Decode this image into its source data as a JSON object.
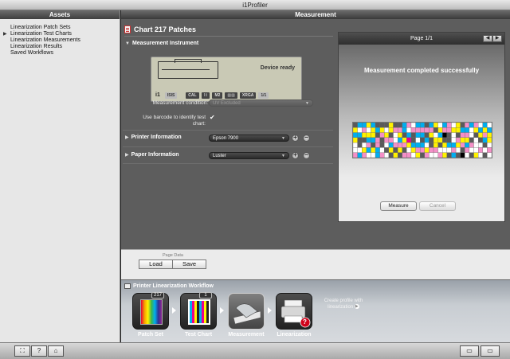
{
  "window": {
    "title": "i1Profiler"
  },
  "sidebar": {
    "header": "Assets",
    "items": [
      {
        "label": "Linearization Patch Sets",
        "selected": false
      },
      {
        "label": "Linearization Test Charts",
        "selected": true
      },
      {
        "label": "Linearization Measurements",
        "selected": false
      },
      {
        "label": "Linearization Results",
        "selected": false
      },
      {
        "label": "Saved Workflows",
        "selected": false
      }
    ]
  },
  "main": {
    "header": "Measurement",
    "chart_title": "Chart 217 Patches",
    "instrument": {
      "section_label": "Measurement Instrument",
      "status": "Device ready",
      "lcd_tags": [
        "i1",
        "ISIS",
        "CAL",
        "M2",
        "XRGA",
        "1/1"
      ]
    },
    "measurement_condition": {
      "label": "Measurement condition:",
      "value": "UV Excluded"
    },
    "barcode": {
      "label": "Use barcode to identify test chart:",
      "checked": true
    },
    "printer": {
      "label": "Printer Information",
      "value": "Epson 7900"
    },
    "paper": {
      "label": "Paper Information",
      "value": "Luster"
    }
  },
  "panel": {
    "page": "Page 1/1",
    "message": "Measurement completed successfully",
    "measure_label": "Measure",
    "cancel_label": "Cancel"
  },
  "page_data": {
    "label": "Page Data",
    "load_label": "Load",
    "save_label": "Save"
  },
  "workflow": {
    "title": "Printer Linearization Workflow",
    "steps": [
      {
        "label": "Patch Set",
        "badge": "217"
      },
      {
        "label": "Test Chart",
        "badge": "1"
      },
      {
        "label": "Measurement",
        "badge": ""
      },
      {
        "label": "Linearization",
        "badge": ""
      }
    ],
    "create_profile": "Create profile with linearization"
  },
  "icons": {
    "chart_doc": "document-icon",
    "fullscreen": "fullscreen-icon",
    "help": "help-icon",
    "home": "home-icon"
  },
  "colors": {
    "main_bg": "#5d5d5d",
    "sidebar_bg": "#e7e7e7",
    "patch_palette": [
      "#00aeef",
      "#ec008c",
      "#fff200",
      "#000000",
      "#ffffff",
      "#b8b8b8",
      "#5a5a5a",
      "#7ad3f3",
      "#f58fc7",
      "#fff799"
    ]
  }
}
